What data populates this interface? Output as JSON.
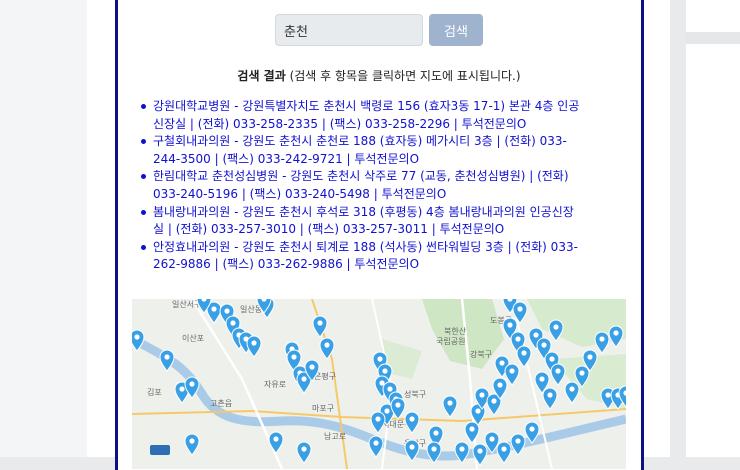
{
  "search": {
    "query": "춘천",
    "button_label": "검색"
  },
  "results": {
    "title": "검색 결과",
    "hint": " (검색 후 항목을 클릭하면 지도에 표시됩니다.)",
    "items": [
      {
        "line1": "강원대학교병원 - 강원특별자치도 춘천시 백령로 156 (효자3동 17-1) 본관 4층 인공",
        "line2": "신장실 | (전화) 033-258-2335 | (팩스) 033-258-2296 | 투석전문의O"
      },
      {
        "line1": "구철회내과의원 - 강원도 춘천시 춘천로 188 (효자동) 메가시티 3층 | (전화) 033-",
        "line2": "244-3500 | (팩스) 033-242-9721 | 투석전문의O"
      },
      {
        "line1": "한림대학교 춘천성심병원 - 강원도 춘천시 삭주로 77 (교동, 춘천성심병원) | (전화)",
        "line2": "033-240-5196 | (팩스) 033-240-5498 | 투석전문의O"
      },
      {
        "line1": "봄내랑내과의원 - 강원도 춘천시 후석로 318 (후평동) 4층 봄내랑내과의원 인공신장",
        "line2": "실 | (전화) 033-257-3010 | (팩스) 033-257-3011 | 투석전문의O"
      },
      {
        "line1": "안정효내과의원 - 강원도 춘천시 퇴계로 188 (석사동) 썬타워빌딩 3층 | (전화) 033-",
        "line2": "262-9886 | (팩스) 033-262-9886 | 투석전문의O"
      }
    ]
  },
  "map": {
    "marker_color": "#3aa0e6",
    "labels": {
      "l1": "일산서구",
      "l2": "일산동구",
      "l3": "이산포",
      "l4": "김포",
      "l5": "고촌읍",
      "l6": "자유로",
      "l7": "은평구",
      "l8": "마포구",
      "l9": "성북구",
      "l10": "북한산",
      "l11": "국립공원",
      "l12": "도봉구",
      "l13": "강북구",
      "l14": "남고로",
      "l15": "용산구",
      "l16": "서대문구"
    }
  }
}
